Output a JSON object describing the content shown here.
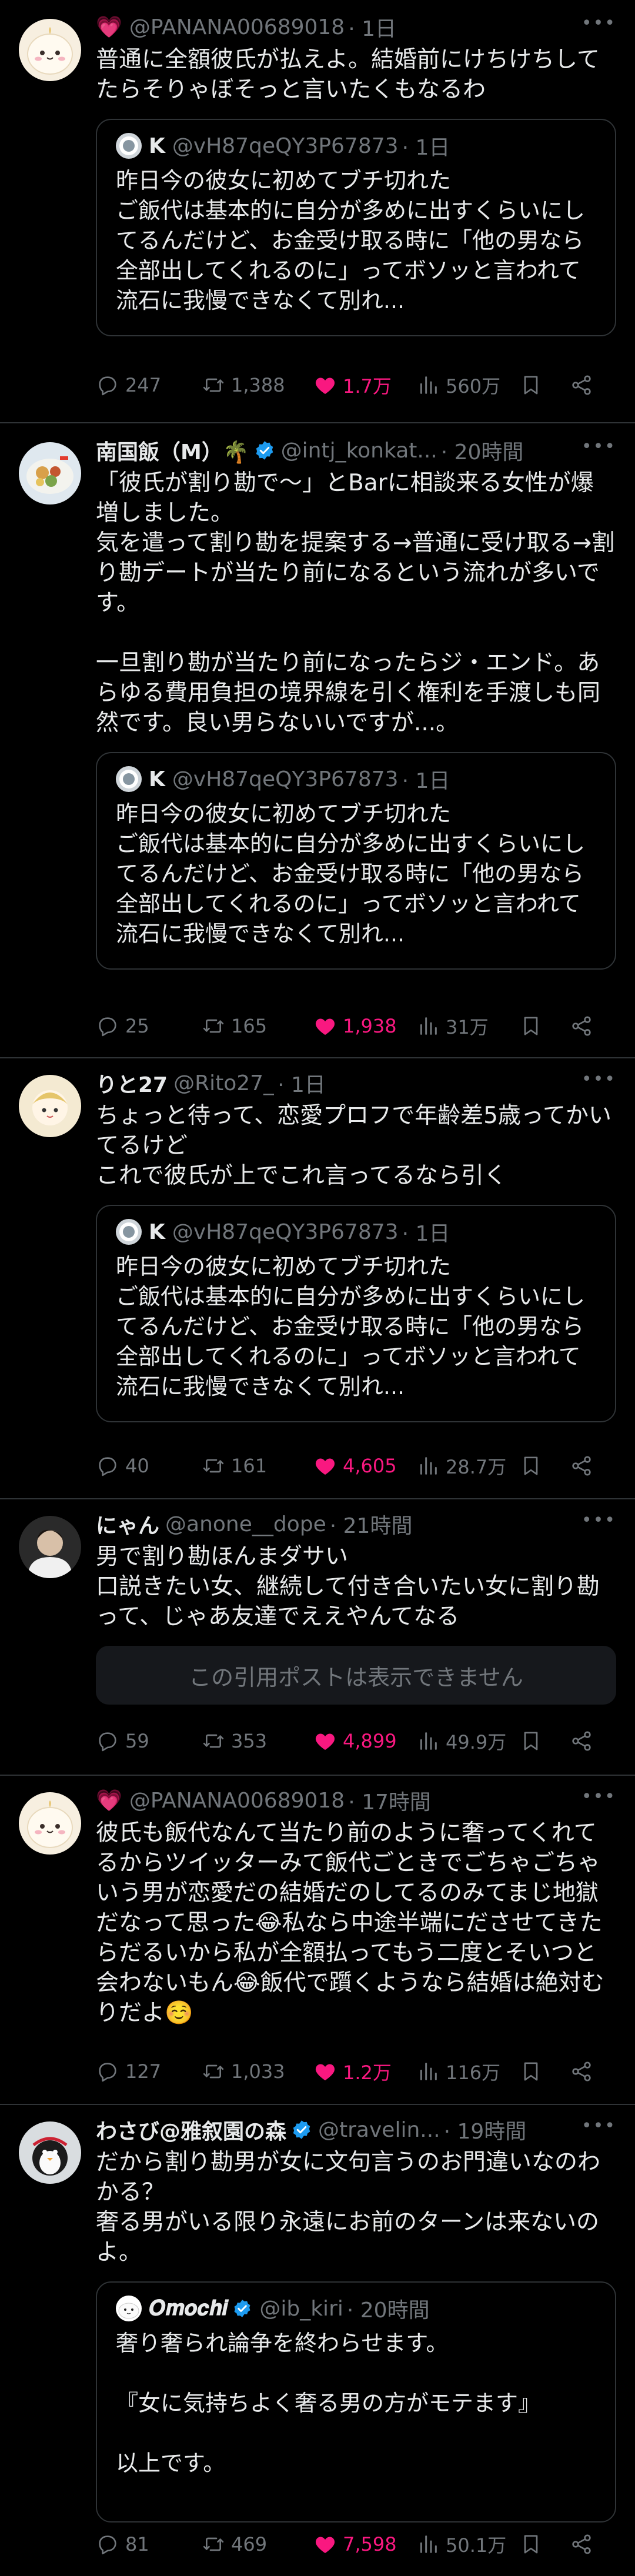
{
  "colors": {
    "background": "#000000",
    "text": "#e7e9ea",
    "muted": "#71767b",
    "like": "#f91880",
    "verified": "#1d9bf0",
    "border": "#2f3336"
  },
  "quoted": {
    "name": "K",
    "handle": "@vH87qeQY3P67873",
    "time": "· 1日",
    "text": "昨日今の彼女に初めてブチ切れた\nご飯代は基本的に自分が多めに出すくらいにしてるんだけど、お金受け取る時に「他の男なら全部出してくれるのに」ってボソッと言われて流石に我慢できなくて別れ..."
  },
  "posts": [
    {
      "emoji": "💗",
      "name": "",
      "handle": "@PANANA00689018",
      "time": "· 1日",
      "text": "普通に全額彼氏が払えよ。結婚前にけちけちしてたらそりゃぼそっと言いたくもなるわ",
      "reply": "247",
      "repost": "1,388",
      "like": "1.7万",
      "views": "560万"
    },
    {
      "name": "南国飯（M）🌴",
      "handle": "@intj_konkat...",
      "time": "· 20時間",
      "text": "「彼氏が割り勘で〜」とBarに相談来る女性が爆増しました。\n気を遣って割り勘を提案する→普通に受け取る→割り勘デートが当たり前になるという流れが多いです。\n\n一旦割り勘が当たり前になったらジ・エンド。あらゆる費用負担の境界線を引く権利を手渡しも同然です。良い男らないいですが...。",
      "reply": "25",
      "repost": "165",
      "like": "1,938",
      "views": "31万"
    },
    {
      "name": "りと27",
      "handle": "@Rito27_",
      "time": "· 1日",
      "text": "ちょっと待って、恋愛プロフで年齢差5歳ってかいてるけど\nこれで彼氏が上でこれ言ってるなら引く",
      "reply": "40",
      "repost": "161",
      "like": "4,605",
      "views": "28.7万"
    },
    {
      "name": "にゃん",
      "handle": "@anone__dope",
      "time": "· 21時間",
      "text": "男で割り勘ほんまダサい\n口説きたい女、継続して付き合いたい女に割り勘って、じゃあ友達でええやんてなる",
      "unavailable": "この引用ポストは表示できません",
      "reply": "59",
      "repost": "353",
      "like": "4,899",
      "views": "49.9万"
    },
    {
      "emoji": "💗",
      "name": "",
      "handle": "@PANANA00689018",
      "time": "· 17時間",
      "text": "彼氏も飯代なんて当たり前のように奢ってくれてるからツイッターみて飯代ごときでごちゃごちゃいう男が恋愛だの結婚だのしてるのみてまじ地獄だなって思った😂私なら中途半端にださせてきたらだるいから私が全額払ってもう二度とそいつと会わないもん😂飯代で躓くようなら結婚は絶対むりだよ☺️",
      "reply": "127",
      "repost": "1,033",
      "like": "1.2万",
      "views": "116万"
    },
    {
      "name": "わさび@雅叙園の森",
      "handle": "@travelin...",
      "time": "· 19時間",
      "text": "だから割り勘男が女に文句言うのお門違いなのわかる？\n奢る男がいる限り永遠にお前のターンは来ないのよ。",
      "quote": {
        "name": "𝑶𝒎𝒐𝒄𝒉𝒊",
        "handle": "@ib_kiri",
        "time": "· 20時間",
        "text": "奢り奢られ論争を終わらせます。\n\n『女に気持ちよく奢る男の方がモテます』\n\n以上です。"
      },
      "reply": "81",
      "repost": "469",
      "like": "7,598",
      "views": "50.1万"
    }
  ]
}
